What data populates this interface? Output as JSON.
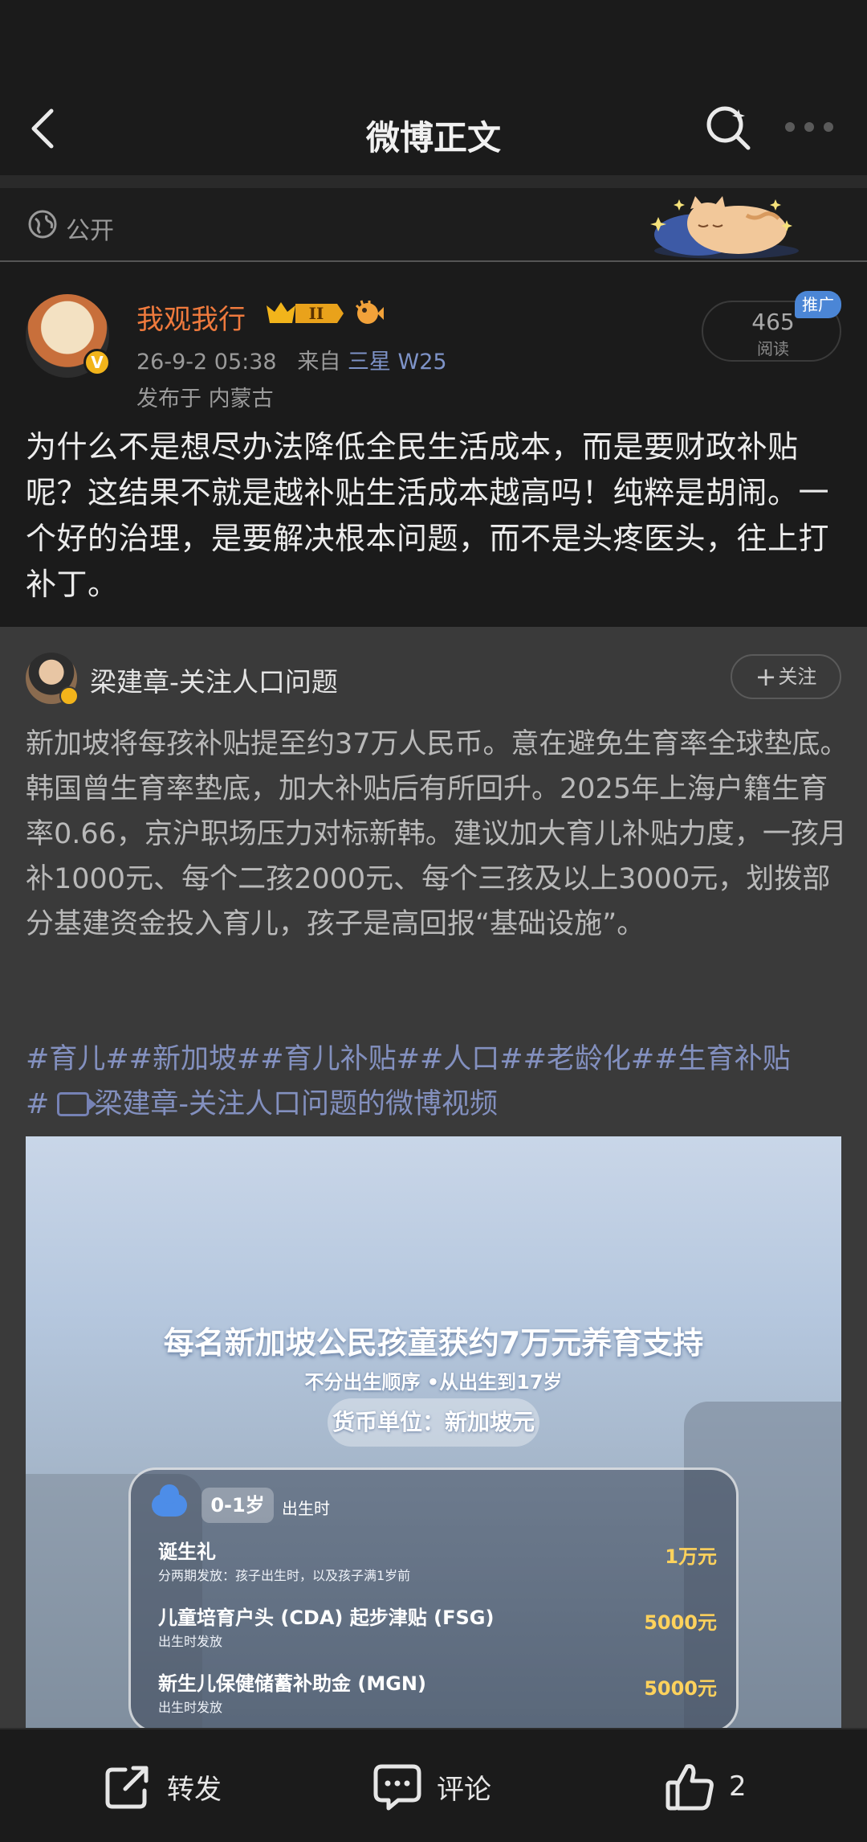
{
  "header": {
    "title": "微博正文"
  },
  "privacy": {
    "label": "公开"
  },
  "post": {
    "author": "我观我行",
    "level_badge": "II",
    "time": "26-9-2 05:38",
    "from_prefix": "来自",
    "source": "三星 W25",
    "location": "发布于 内蒙古",
    "read_count": "465",
    "read_label": "阅读",
    "promo_tag": "推广",
    "text": "为什么不是想尽办法降低全民生活成本，而是要财政补贴呢？这结果不就是越补贴生活成本越高吗！纯粹是胡闹。一个好的治理，是要解决根本问题，而不是头疼医头，往上打补丁。"
  },
  "repost": {
    "author": "梁建章-关注人口问题",
    "follow_label": "关注",
    "text": "新加坡将每孩补贴提至约37万人民币。意在避免生育率全球垫底。韩国曾生育率垫底，加大补贴后有所回升。2025年上海户籍生育率0.66，京沪职场压力对标新韩。建议加大育儿补贴力度，一孩月补1000元、每个二孩2000元、每个三孩及以上3000元，划拨部分基建资金投入育儿，孩子是高回报“基础设施”。",
    "tags": "#育儿##新加坡##育儿补贴##人口##老龄化##生育补贴",
    "tags_line2_prefix": "#",
    "video_link": "梁建章-关注人口问题的微博视频"
  },
  "video": {
    "headline": "每名新加坡公民孩童获约7万元养育支持",
    "subline": "不分出生顺序 •从出生到17岁",
    "currency": "货币单位：新加坡元",
    "age_tag": "0-1岁",
    "age_note": "出生时",
    "rows": [
      {
        "title": "诞生礼",
        "note": "分两期发放：孩子出生时，以及孩子满1岁前",
        "amount": "1万元"
      },
      {
        "title": "儿童培育户头 (CDA) 起步津贴 (FSG)",
        "note": "出生时发放",
        "amount": "5000元"
      },
      {
        "title": "新生儿保健储蓄补助金 (MGN)",
        "note": "出生时发放",
        "amount": "5000元"
      }
    ]
  },
  "actions": {
    "repost_label": "转发",
    "comment_label": "评论",
    "like_count": "2"
  },
  "colors": {
    "username": "#ef7a3d",
    "link": "#8390bf",
    "promo": "#4b86d6",
    "amount": "#ffd25c"
  },
  "icons": [
    "back-arrow-icon",
    "search-icon",
    "more-icon",
    "globe-icon",
    "verified-badge-icon",
    "crown-badge-icon",
    "pufferfish-icon",
    "plus-icon",
    "video-icon",
    "cloud-icon",
    "share-icon",
    "comment-icon",
    "thumbs-up-icon"
  ]
}
